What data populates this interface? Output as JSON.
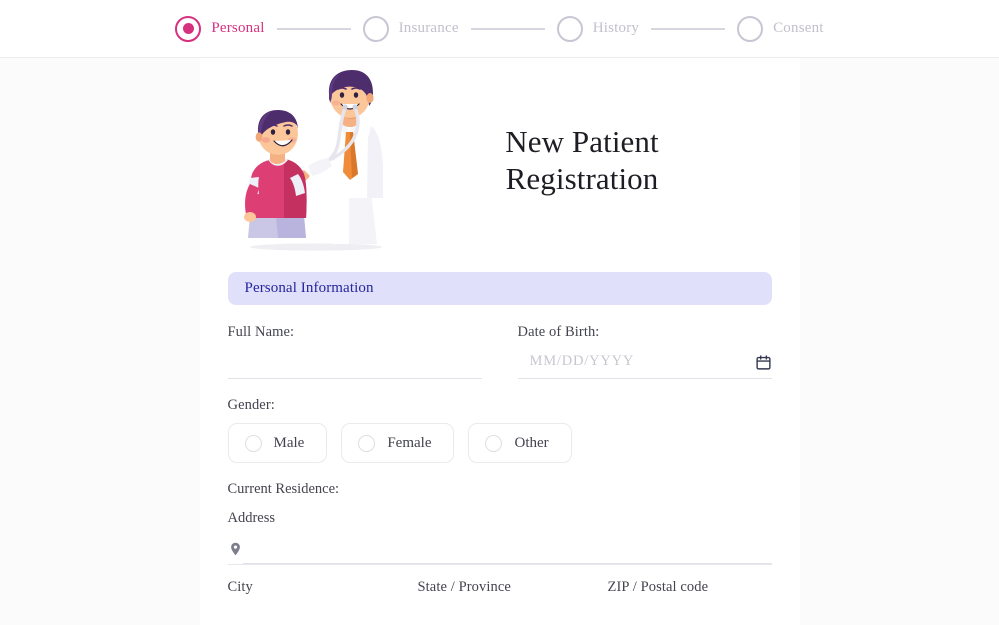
{
  "stepper": {
    "steps": [
      {
        "label": "Personal",
        "state": "active",
        "icon": "filled-circle-icon"
      },
      {
        "label": "Insurance",
        "state": "inactive",
        "icon": "empty-circle-icon"
      },
      {
        "label": "History",
        "state": "inactive",
        "icon": "empty-circle-icon"
      },
      {
        "label": "Consent",
        "state": "inactive",
        "icon": "empty-circle-icon"
      }
    ]
  },
  "hero": {
    "title": "New Patient Registration",
    "title_line1": "New Patient",
    "title_line2": "Registration",
    "illustration": "doctor-examining-child-illustration"
  },
  "section": {
    "personal_information_label": "Personal Information"
  },
  "form": {
    "full_name": {
      "label": "Full Name:",
      "value": "",
      "placeholder": ""
    },
    "date_of_birth": {
      "label": "Date of Birth:",
      "value": "",
      "placeholder": "MM/DD/YYYY",
      "icon": "calendar-icon"
    },
    "gender": {
      "label": "Gender:",
      "options": [
        {
          "label": "Male",
          "selected": false
        },
        {
          "label": "Female",
          "selected": false
        },
        {
          "label": "Other",
          "selected": false
        }
      ]
    },
    "residence": {
      "heading": "Current Residence:",
      "address": {
        "label": "Address",
        "value": "",
        "placeholder": "",
        "icon": "map-pin-icon"
      },
      "city": {
        "label": "City",
        "value": "",
        "placeholder": ""
      },
      "state": {
        "label": "State / Province",
        "value": "",
        "placeholder": ""
      },
      "zip": {
        "label": "ZIP / Postal code",
        "value": "",
        "placeholder": ""
      }
    }
  },
  "colors": {
    "accent_pink": "#d6317f",
    "section_bar_bg": "#e1e0fb",
    "section_bar_text": "#25259c",
    "inactive_step": "#c3c0cc",
    "page_bg": "#fbfbfc",
    "card_bg": "#ffffff"
  }
}
